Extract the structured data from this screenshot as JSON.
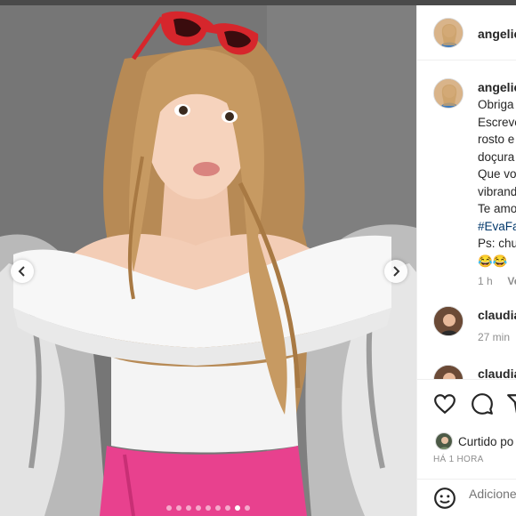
{
  "post": {
    "username": "angelic",
    "image_dots_total": 9,
    "image_dot_active": 8
  },
  "caption": {
    "username": "angelic",
    "lines": [
      "Obriga",
      "Escreve",
      "rosto e",
      "doçura",
      "Que vo",
      "vibrand",
      "Te amo"
    ],
    "hashtag": "#EvaFa",
    "ps_line": "Ps: chu",
    "emoji": "😂😂",
    "time": "1 h",
    "reply": "Ve"
  },
  "comments": [
    {
      "username": "claudia",
      "time": "27 min"
    },
    {
      "username": "claudia"
    }
  ],
  "likes": {
    "text": "Curtido po",
    "time_ago": "HÁ 1 HORA"
  },
  "add_comment": {
    "placeholder": "Adicione"
  },
  "icons": {
    "like": "heart-icon",
    "comment": "comment-icon",
    "share": "share-icon",
    "emoji": "emoji-icon",
    "prev": "chevron-left-icon",
    "next": "chevron-right-icon"
  }
}
